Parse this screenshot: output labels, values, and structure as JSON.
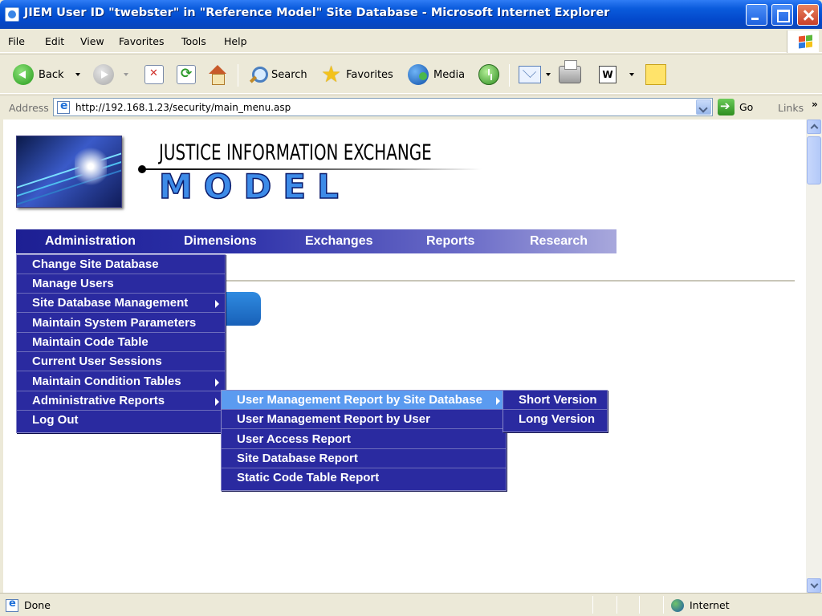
{
  "window": {
    "title": "JIEM User ID \"twebster\" in \"Reference Model\" Site Database - Microsoft Internet Explorer"
  },
  "menubar": [
    "File",
    "Edit",
    "View",
    "Favorites",
    "Tools",
    "Help"
  ],
  "toolbar": {
    "back": "Back",
    "search": "Search",
    "favorites": "Favorites",
    "media": "Media"
  },
  "address": {
    "label": "Address",
    "url": "http://192.168.1.23/security/main_menu.asp",
    "go": "Go",
    "links": "Links",
    "more": "»"
  },
  "logo": {
    "line1": "JUSTICE INFORMATION EXCHANGE",
    "line2": "MODEL"
  },
  "nav": [
    "Administration",
    "Dimensions",
    "Exchanges",
    "Reports",
    "Research"
  ],
  "admin_menu": [
    {
      "label": "Change Site Database",
      "submenu": false
    },
    {
      "label": "Manage Users",
      "submenu": false
    },
    {
      "label": "Site Database Management",
      "submenu": true
    },
    {
      "label": "Maintain System Parameters",
      "submenu": false
    },
    {
      "label": "Maintain Code Table",
      "submenu": false
    },
    {
      "label": "Current User Sessions",
      "submenu": false
    },
    {
      "label": "Maintain Condition Tables",
      "submenu": true
    },
    {
      "label": "Administrative Reports",
      "submenu": true
    },
    {
      "label": "Log Out",
      "submenu": false
    }
  ],
  "reports_menu": [
    {
      "label": "User Management Report by Site Database",
      "submenu": true,
      "highlighted": true
    },
    {
      "label": "User Management Report by User",
      "submenu": false
    },
    {
      "label": "User Access Report",
      "submenu": false
    },
    {
      "label": "Site Database Report",
      "submenu": false
    },
    {
      "label": "Static Code Table Report",
      "submenu": false
    }
  ],
  "version_menu": [
    {
      "label": "Short Version"
    },
    {
      "label": "Long Version"
    }
  ],
  "status": {
    "text": "Done",
    "zone": "Internet"
  },
  "colors": {
    "menu_bg": "#2A2AA0",
    "menu_highlight": "#5B9BF0",
    "nav_start": "#1D1F93",
    "titlebar": "#0A5BDC"
  }
}
